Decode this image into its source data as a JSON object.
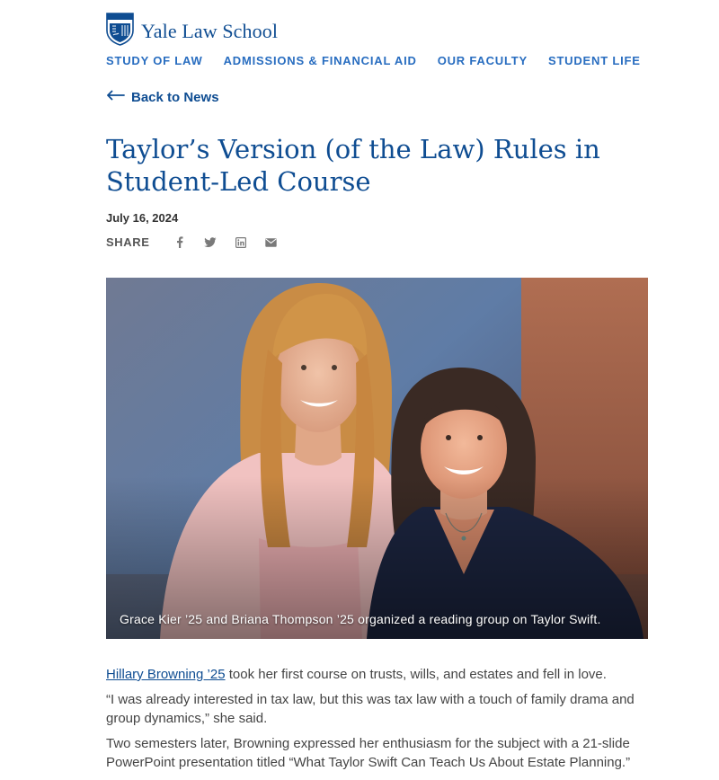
{
  "header": {
    "site_name": "Yale Law School",
    "logo_icon": "shield-icon",
    "nav": [
      {
        "label": "STUDY OF LAW"
      },
      {
        "label": "ADMISSIONS & FINANCIAL AID"
      },
      {
        "label": "OUR FACULTY"
      },
      {
        "label": "STUDENT LIFE"
      }
    ]
  },
  "back_link": {
    "label": "Back to News",
    "icon": "arrow-left-icon"
  },
  "article": {
    "title": "Taylor’s Version (of the Law) Rules in Student-Led Course",
    "date": "July 16, 2024",
    "share": {
      "label": "SHARE",
      "icons": [
        "facebook-icon",
        "twitter-icon",
        "linkedin-icon",
        "email-icon"
      ]
    },
    "image": {
      "caption": "Grace Kier ’25 and Briana Thompson ’25 organized a reading group on Taylor Swift."
    },
    "paragraphs": {
      "p1_link": "Hillary Browning ’25",
      "p1_text": " took her first course on trusts, wills, and estates and fell in love.",
      "p2": "“I was already interested in tax law, but this was tax law with a touch of family drama and group dynamics,” she said.",
      "p3": "Two semesters later, Browning expressed her enthusiasm for the subject with a 21-slide PowerPoint presentation titled “What Taylor Swift Can Teach Us About Estate Planning.”"
    }
  },
  "colors": {
    "brand_blue": "#0f4d92",
    "nav_blue": "#286dc0",
    "text": "#444444"
  }
}
